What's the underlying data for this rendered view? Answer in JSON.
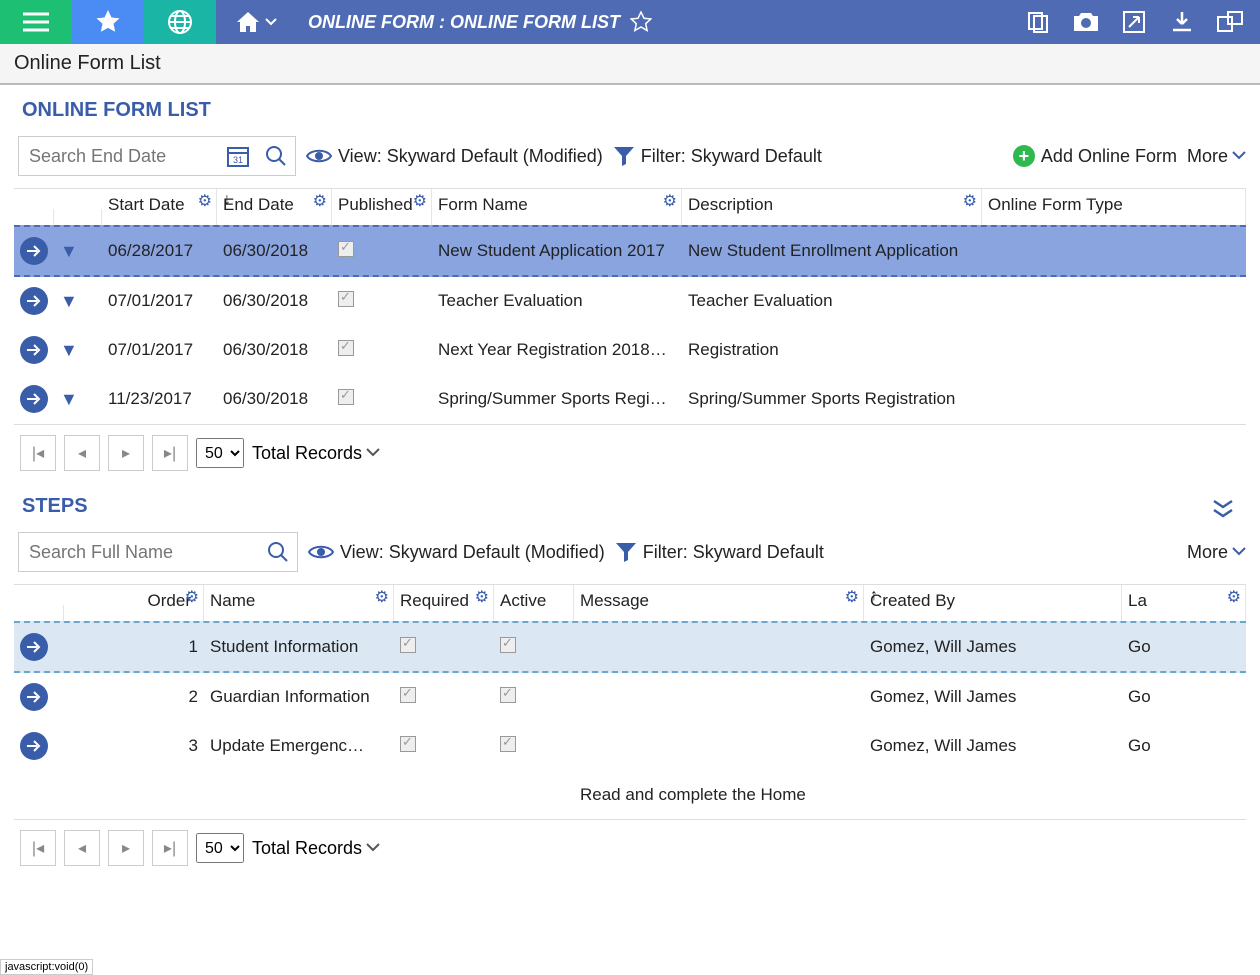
{
  "header": {
    "title": "ONLINE FORM : ONLINE FORM LIST"
  },
  "breadcrumb": "Online Form List",
  "forms": {
    "section_title": "ONLINE FORM LIST",
    "search_placeholder": "Search End Date",
    "view_label": "View: Skyward Default (Modified)",
    "filter_label": "Filter: Skyward Default",
    "add_label": "Add Online Form",
    "more_label": "More",
    "columns": {
      "start": "Start Date",
      "end": "End Date",
      "published": "Published",
      "name": "Form Name",
      "desc": "Description",
      "type": "Online Form Type"
    },
    "rows": [
      {
        "start": "06/28/2017",
        "end": "06/30/2018",
        "name": "New Student Application 2017",
        "desc": "New Student Enrollment Application",
        "selected": true
      },
      {
        "start": "07/01/2017",
        "end": "06/30/2018",
        "name": "Teacher Evaluation",
        "desc": "Teacher Evaluation",
        "selected": false
      },
      {
        "start": "07/01/2017",
        "end": "06/30/2018",
        "name": "Next Year Registration 2018…",
        "desc": "Registration",
        "selected": false
      },
      {
        "start": "11/23/2017",
        "end": "06/30/2018",
        "name": "Spring/Summer Sports Regi…",
        "desc": "Spring/Summer Sports Registration",
        "selected": false
      }
    ],
    "page_size": "50",
    "total_label": "Total Records"
  },
  "steps": {
    "section_title": "STEPS",
    "search_placeholder": "Search Full Name",
    "view_label": "View: Skyward Default (Modified)",
    "filter_label": "Filter: Skyward Default",
    "more_label": "More",
    "columns": {
      "order": "Order",
      "name": "Name",
      "required": "Required",
      "active": "Active",
      "message": "Message",
      "created_by": "Created By",
      "last": "La"
    },
    "rows": [
      {
        "order": "1",
        "name": "Student Information",
        "msg": "",
        "by": "Gomez, Will James",
        "last": "Go",
        "selected": true
      },
      {
        "order": "2",
        "name": "Guardian Information",
        "msg": "",
        "by": "Gomez, Will James",
        "last": "Go",
        "selected": false
      },
      {
        "order": "3",
        "name": "Update Emergenc…",
        "msg": "",
        "by": "Gomez, Will James",
        "last": "Go",
        "selected": false
      }
    ],
    "extra_msg": "Read and complete the Home",
    "page_size": "50",
    "total_label": "Total Records"
  },
  "status": "javascript:void(0)"
}
